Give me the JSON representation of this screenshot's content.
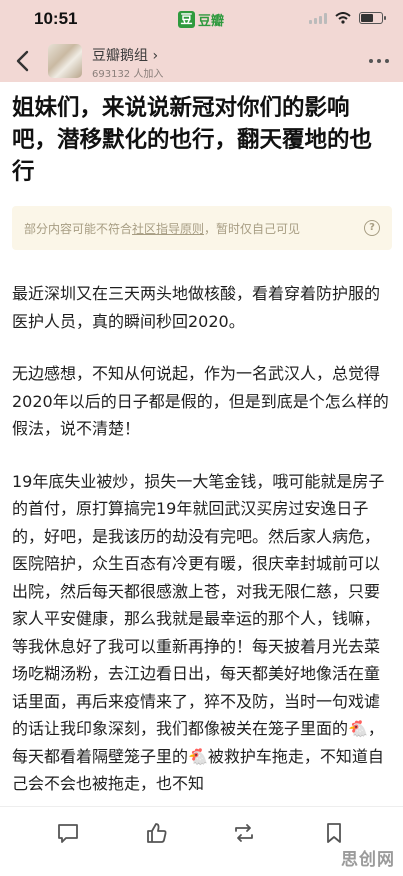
{
  "status": {
    "time": "10:51",
    "app_label": "豆瓣"
  },
  "header": {
    "group_name": "豆瓣鹅组 ›",
    "group_members": "693132 人加入"
  },
  "post": {
    "title": "姐妹们，来说说新冠对你们的影响吧，潜移默化的也行，翻天覆地的也行",
    "notice_prefix": "部分内容可能不符合",
    "notice_link": "社区指导原则",
    "notice_suffix": "，暂时仅自己可见",
    "paragraphs": [
      "最近深圳又在三天两头地做核酸，看着穿着防护服的医护人员，真的瞬间秒回2020。",
      "无边感想，不知从何说起，作为一名武汉人，总觉得2020年以后的日子都是假的，但是到底是个怎么样的假法，说不清楚！",
      "19年底失业被炒，损失一大笔金钱，哦可能就是房子的首付，原打算搞完19年就回武汉买房过安逸日子的，好吧，是我该历的劫没有完吧。然后家人病危，医院陪护，众生百态有冷更有暖，很庆幸封城前可以出院，然后每天都很感激上苍，对我无限仁慈，只要家人平安健康，那么我就是最幸运的那个人，钱嘛，等我休息好了我可以重新再挣的！每天披着月光去菜场吃糊汤粉，去江边看日出，每天都美好地像活在童话里面，再后来疫情来了，猝不及防，当时一句戏谑的话让我印象深刻，我们都像被关在笼子里面的🐔，每天都看着隔壁笼子里的🐔被救护车拖走，不知道自己会不会也被拖走，也不知"
    ]
  },
  "watermark": "思创网"
}
